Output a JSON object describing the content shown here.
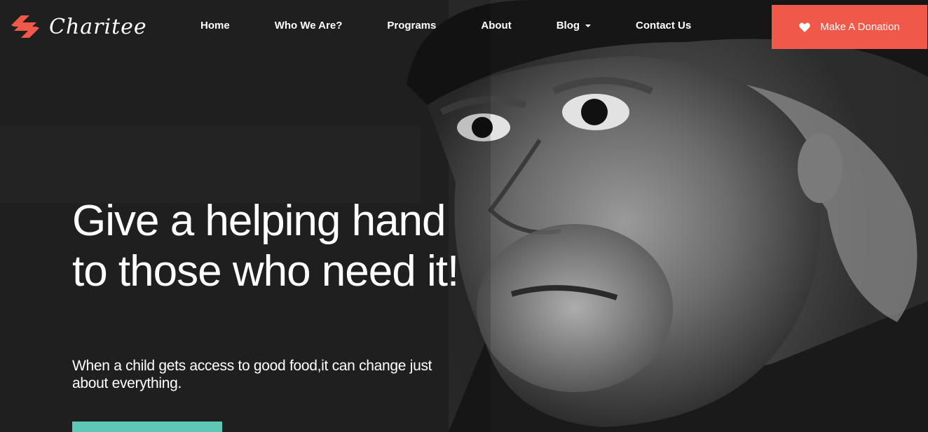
{
  "brand": {
    "name": "Charitee",
    "accent_color": "#f0594a",
    "logo_icon": "hand-heart-logo-icon"
  },
  "nav": {
    "items": [
      {
        "label": "Home"
      },
      {
        "label": "Who We Are?"
      },
      {
        "label": "Programs"
      },
      {
        "label": "About"
      },
      {
        "label": "Blog",
        "has_dropdown": true
      },
      {
        "label": "Contact Us"
      }
    ]
  },
  "donate": {
    "label": "Make A Donation",
    "icon": "heart-icon",
    "color": "#f0594a"
  },
  "hero": {
    "headline": "Give a helping hand to those who need it!",
    "subtext": "When a child gets access to good food,it can change just about everything.",
    "cta_color": "#5cc8b5"
  }
}
